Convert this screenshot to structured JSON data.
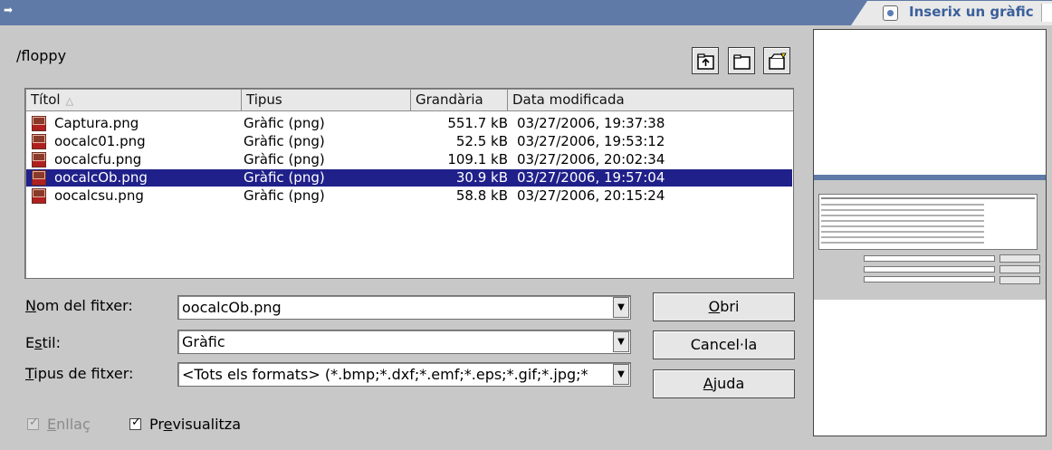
{
  "window": {
    "tab_title": "Inserix un gràfic"
  },
  "path": "/floppy",
  "toolbar": {
    "icons": [
      "folder-up-icon",
      "new-folder-icon",
      "default-directory-icon"
    ]
  },
  "columns": {
    "title": "Títol",
    "type": "Tipus",
    "size": "Grandària",
    "date": "Data modificada"
  },
  "files": [
    {
      "name": "Captura.png",
      "type": "Gràfic (png)",
      "size": "551.7 kB",
      "date": "03/27/2006, 19:37:38"
    },
    {
      "name": "oocalc01.png",
      "type": "Gràfic (png)",
      "size": "52.5 kB",
      "date": "03/27/2006, 19:53:12"
    },
    {
      "name": "oocalcfu.png",
      "type": "Gràfic (png)",
      "size": "109.1 kB",
      "date": "03/27/2006, 20:02:34"
    },
    {
      "name": "oocalcOb.png",
      "type": "Gràfic (png)",
      "size": "30.9 kB",
      "date": "03/27/2006, 19:57:04"
    },
    {
      "name": "oocalcsu.png",
      "type": "Gràfic (png)",
      "size": "58.8 kB",
      "date": "03/27/2006, 20:15:24"
    }
  ],
  "selected_file_index": 3,
  "form": {
    "filename_label_hotkey": "N",
    "filename_label_rest": "om del fitxer:",
    "filename_value": "oocalcOb.png",
    "style_label_pre": "E",
    "style_label_hotkey": "s",
    "style_label_rest": "til:",
    "style_value": "Gràfic",
    "filetype_label_hotkey": "T",
    "filetype_label_rest": "ipus de fitxer:",
    "filetype_value": "<Tots els formats> (*.bmp;*.dxf;*.emf;*.eps;*.gif;*.jpg;*"
  },
  "buttons": {
    "open_hotkey": "O",
    "open_rest": "bri",
    "cancel": "Cancel·la",
    "help_hotkey": "A",
    "help_rest": "juda"
  },
  "checkboxes": {
    "link_hotkey": "E",
    "link_rest": "nllaç",
    "link_checked": true,
    "link_enabled": false,
    "preview_pre": "Pr",
    "preview_hotkey": "e",
    "preview_rest": "visualitza",
    "preview_checked": true
  }
}
